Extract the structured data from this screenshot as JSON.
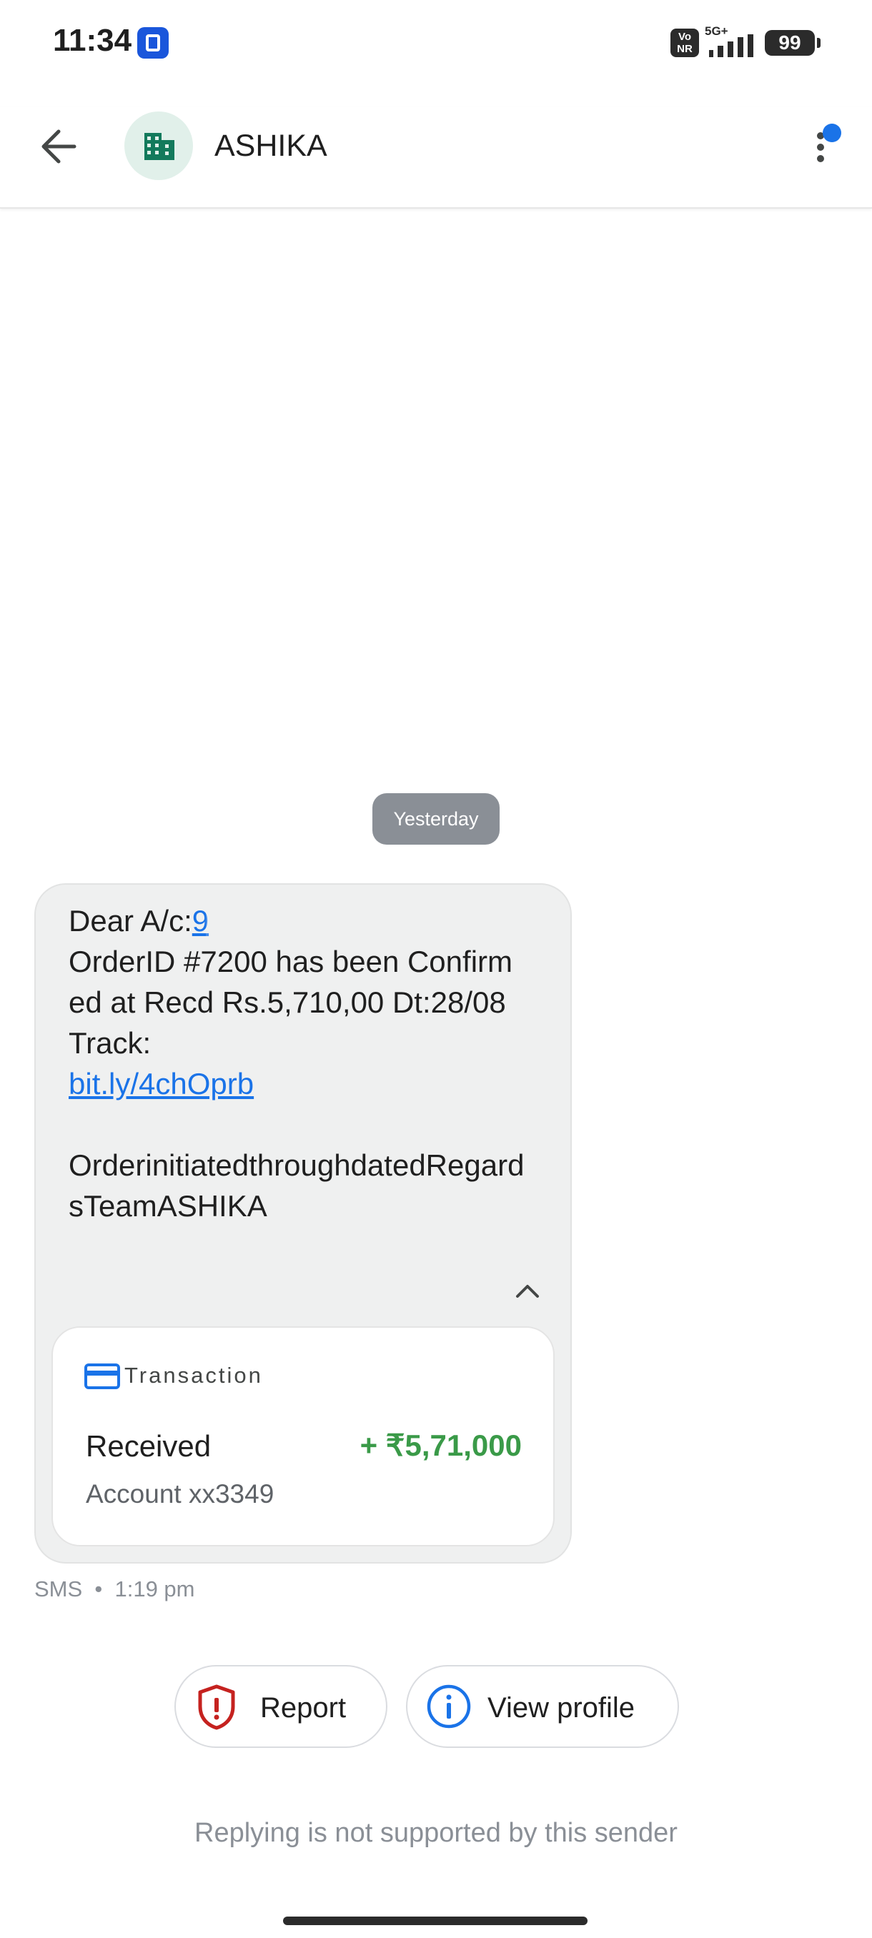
{
  "status_bar": {
    "time": "11:34",
    "volte_label": "Vo\nNR",
    "network": "5G+",
    "battery": "99"
  },
  "header": {
    "contact_name": "ASHIKA",
    "back_icon": "arrow-back-icon",
    "avatar_icon": "business-building-icon",
    "menu_icon": "more-vert-icon",
    "notification_dot_color": "#1a73e8"
  },
  "conversation": {
    "date_chip": "Yesterday",
    "message": {
      "prefix": "Dear A/c:",
      "account_link": "9",
      "line2": "OrderID #7200 has been Confirmed at Recd Rs.5,710,00 Dt:28/08 Track:",
      "link": "bit.ly/4chOprb",
      "footer": "OrderinitiatedthroughdatedRegardsTeamASHIKA"
    },
    "transaction": {
      "label": "Transaction",
      "type": "Received",
      "amount": "+ ₹5,71,000",
      "account": "Account xx3349",
      "amount_color": "#3a9a48"
    },
    "meta": "SMS  •  1:19 pm"
  },
  "actions": {
    "report_label": "Report",
    "view_profile_label": "View profile"
  },
  "reply_note": "Replying is not supported by this sender"
}
